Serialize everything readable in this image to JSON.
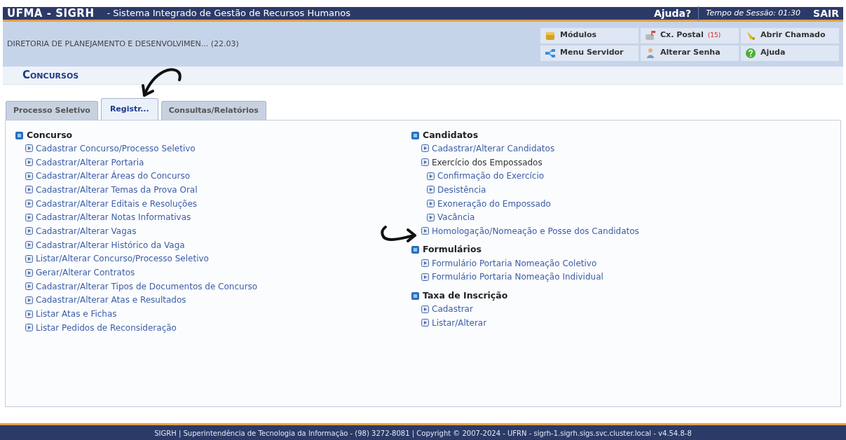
{
  "header": {
    "title": "UFMA - SIGRH",
    "subtitle": "- Sistema Integrado de Gestão de Recursos Humanos",
    "help": "Ajuda?",
    "session": "Tempo de Sessão: 01:30",
    "logout": "SAIR"
  },
  "unit": "DIRETORIA DE PLANEJAMENTO E DESENVOLVIMEN... (22.03)",
  "shortcuts": [
    {
      "label": "Módulos",
      "kind": "box"
    },
    {
      "label": "Cx. Postal",
      "count": "(15)",
      "kind": "mail"
    },
    {
      "label": "Abrir Chamado",
      "kind": "bell"
    },
    {
      "label": "Menu Servidor",
      "kind": "tree"
    },
    {
      "label": "Alterar Senha",
      "kind": "person"
    },
    {
      "label": "Ajuda",
      "kind": "help"
    }
  ],
  "module_title": "Concursos",
  "tabs": [
    {
      "label": "Processo Seletivo",
      "selected": false
    },
    {
      "label": "Registr...",
      "selected": true
    },
    {
      "label": "Consultas/Relatórios",
      "selected": false
    }
  ],
  "columns": [
    [
      {
        "title": "Concurso",
        "items": [
          {
            "label": "Cadastrar Concurso/Processo Seletivo"
          },
          {
            "label": "Cadastrar/Alterar Portaria"
          },
          {
            "label": "Cadastrar/Alterar Áreas do Concurso"
          },
          {
            "label": "Cadastrar/Alterar Temas da Prova Oral"
          },
          {
            "label": "Cadastrar/Alterar Editais e Resoluções"
          },
          {
            "label": "Cadastrar/Alterar Notas Informativas"
          },
          {
            "label": "Cadastrar/Alterar Vagas"
          },
          {
            "label": "Cadastrar/Alterar Histórico da Vaga"
          },
          {
            "label": "Listar/Alterar Concurso/Processo Seletivo"
          },
          {
            "label": "Gerar/Alterar Contratos"
          },
          {
            "label": "Cadastrar/Alterar Tipos de Documentos de Concurso"
          },
          {
            "label": "Cadastrar/Alterar Atas e Resultados"
          },
          {
            "label": "Listar Atas e Fichas"
          },
          {
            "label": "Listar Pedidos de Reconsideração"
          }
        ]
      }
    ],
    [
      {
        "title": "Candidatos",
        "items": [
          {
            "label": "Cadastrar/Alterar Candidatos"
          },
          {
            "label": "Exercício dos Empossados",
            "children": [
              {
                "label": "Confirmação do Exercício"
              },
              {
                "label": "Desistência"
              },
              {
                "label": "Exoneração do Empossado"
              },
              {
                "label": "Vacância"
              }
            ]
          },
          {
            "label": "Homologação/Nomeação e Posse dos Candidatos"
          }
        ]
      },
      {
        "title": "Formulários",
        "items": [
          {
            "label": "Formulário Portaria Nomeação Coletivo"
          },
          {
            "label": "Formulário Portaria Nomeação Individual"
          }
        ]
      },
      {
        "title": "Taxa de Inscrição",
        "items": [
          {
            "label": "Cadastrar"
          },
          {
            "label": "Listar/Alterar"
          }
        ]
      }
    ]
  ],
  "footer": "SIGRH | Superintendência de Tecnologia da Informação - (98) 3272-8081 | Copyright © 2007-2024 - UFRN - sigrh-1.sigrh.sigs.svc.cluster.local - v4.54.8-8"
}
